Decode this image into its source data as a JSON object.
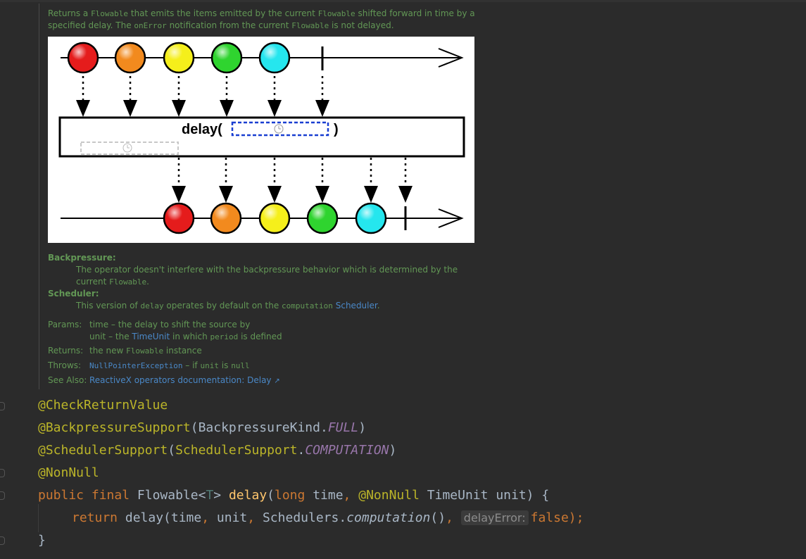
{
  "doc": {
    "intro": [
      {
        "t": "Returns a "
      },
      {
        "c": "Flowable"
      },
      {
        "t": " that emits the items emitted by the current "
      },
      {
        "c": "Flowable"
      },
      {
        "t": " shifted forward in time by a specified delay. The "
      },
      {
        "c": "onError"
      },
      {
        "t": " notification from the current "
      },
      {
        "c": "Flowable"
      },
      {
        "t": " is not delayed."
      }
    ],
    "diagram": {
      "operator_label": "delay(",
      "operator_close": ")",
      "marble_colors": [
        "#e51c1c",
        "#f28a1e",
        "#f5ef1b",
        "#2fd42f",
        "#25e6ee"
      ]
    },
    "backpressure": {
      "term": "Backpressure:",
      "desc": [
        {
          "t": "The operator doesn't interfere with the backpressure behavior which is determined by the current "
        },
        {
          "c": "Flowable"
        },
        {
          "t": "."
        }
      ]
    },
    "scheduler": {
      "term": "Scheduler:",
      "desc": [
        {
          "t": "This version of "
        },
        {
          "c": "delay"
        },
        {
          "t": " operates by default on the "
        },
        {
          "c": "computation"
        },
        {
          "t": " "
        },
        {
          "l": "Scheduler"
        },
        {
          "t": "."
        }
      ]
    },
    "params": {
      "label": "Params:",
      "lines": [
        [
          {
            "t": "time – the delay to shift the source by"
          }
        ],
        [
          {
            "t": "unit – the "
          },
          {
            "l": "TimeUnit"
          },
          {
            "t": " in which "
          },
          {
            "c": "period"
          },
          {
            "t": " is defined"
          }
        ]
      ]
    },
    "returns": {
      "label": "Returns:",
      "value": [
        {
          "t": "the new "
        },
        {
          "c": "Flowable"
        },
        {
          "t": " instance"
        }
      ]
    },
    "throws": {
      "label": "Throws:",
      "value": [
        {
          "lc": "NullPointerException"
        },
        {
          "t": " – if "
        },
        {
          "c": "unit"
        },
        {
          "t": " is "
        },
        {
          "c": "null"
        }
      ]
    },
    "see_also": {
      "label": "See Also:",
      "link": "ReactiveX operators documentation: Delay",
      "link_icon": "external-link-icon"
    }
  },
  "code": {
    "line1": "@CheckReturnValue",
    "line2": [
      {
        "k": "ann",
        "v": "@BackpressureSupport"
      },
      {
        "v": "(BackpressureKind."
      },
      {
        "k": "it",
        "v": "FULL"
      },
      {
        "v": ")"
      }
    ],
    "line3": [
      {
        "k": "ann",
        "v": "@SchedulerSupport"
      },
      {
        "v": "("
      },
      {
        "k": "ann",
        "v": "SchedulerSupport"
      },
      {
        "v": "."
      },
      {
        "k": "it",
        "v": "COMPUTATION"
      },
      {
        "v": ")"
      }
    ],
    "line4": "@NonNull",
    "line5": [
      {
        "k": "kw",
        "v": "public final "
      },
      {
        "v": "Flowable<"
      },
      {
        "k": "tp",
        "v": "T"
      },
      {
        "v": "> "
      },
      {
        "k": "fn",
        "v": "delay"
      },
      {
        "v": "("
      },
      {
        "k": "kw",
        "v": "long "
      },
      {
        "v": "time"
      },
      {
        "k": "kw",
        "v": ", "
      },
      {
        "k": "ann",
        "v": "@NonNull "
      },
      {
        "v": "TimeUnit unit) {"
      }
    ],
    "line6": [
      {
        "k": "kw",
        "v": "return "
      },
      {
        "v": "delay(time"
      },
      {
        "k": "kw",
        "v": ", "
      },
      {
        "v": "unit"
      },
      {
        "k": "kw",
        "v": ", "
      },
      {
        "v": "Schedulers."
      },
      {
        "k": "itp",
        "v": "computation"
      },
      {
        "v": "()"
      },
      {
        "k": "kw",
        "v": ", "
      },
      {
        "k": "hint",
        "v": "delayError:"
      },
      {
        "k": "kw",
        "v": "false"
      },
      {
        "k": "kw",
        "v": ");"
      }
    ],
    "line7": "}"
  }
}
